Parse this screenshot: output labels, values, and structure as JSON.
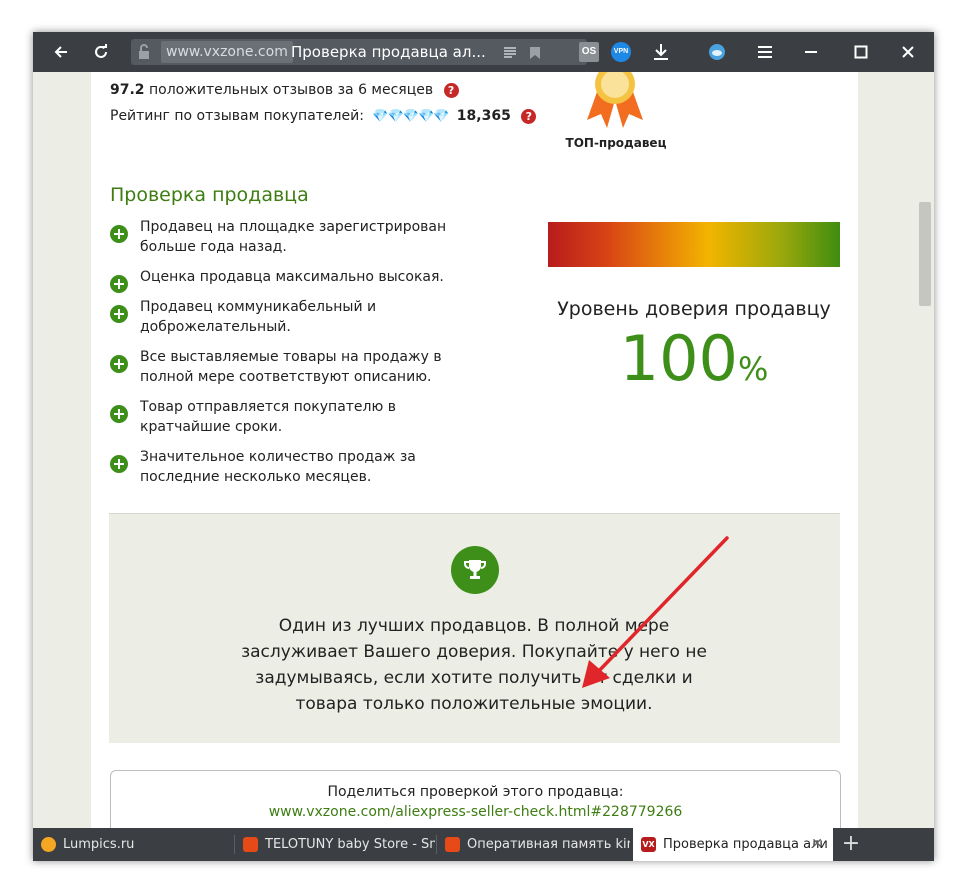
{
  "browser": {
    "address_domain": "www.vxzone.com",
    "address_title": "Проверка продавца ал...",
    "extensions": {
      "os_label": "OS",
      "vpn_label": "VPN"
    }
  },
  "seller": {
    "positive_value": "97.2",
    "positive_text": "положительных отзывов за 6 месяцев",
    "rating_label": "Рейтинг по отзывам покупателей:",
    "rating_value": "18,365",
    "badge_label": "ТОП-продавец"
  },
  "check": {
    "title": "Проверка продавца",
    "items": [
      "Продавец на площадке зарегистрирован больше года назад.",
      "Оценка продавца максимально высокая.",
      "Продавец коммуникабельный и доброжелательный.",
      "Все выставляемые товары на продажу в полной мере соответствуют описанию.",
      "Товар отправляется покупателю в кратчайшие сроки.",
      "Значительное количество продаж за последние несколько месяцев."
    ]
  },
  "trust": {
    "title": "Уровень доверия продавцу",
    "value": "100",
    "unit": "%",
    "percent": 100
  },
  "recommendation": {
    "text": "Один из лучших продавцов. В полной мере заслуживает Вашего доверия. Покупайте у него не задумываясь, если хотите получить от сделки и товара только положительные эмоции."
  },
  "share": {
    "label": "Поделиться проверкой этого продавца:",
    "link": "www.vxzone.com/aliexpress-seller-check.html#228779266"
  },
  "tabs": [
    {
      "label": "Lumpics.ru",
      "icon_color": "#f5a623"
    },
    {
      "label": "TELOTUNY baby Store - Sma",
      "icon_color": "#e64a19"
    },
    {
      "label": "Оперативная память kings",
      "icon_color": "#e64a19"
    },
    {
      "label": "Проверка продавца али",
      "icon_color": "#b71c1c",
      "icon_text": "VX",
      "active": true
    }
  ],
  "colors": {
    "accent_green": "#3e8f1a",
    "toolbar": "#3b3f44",
    "arrow": "#e0262b"
  }
}
